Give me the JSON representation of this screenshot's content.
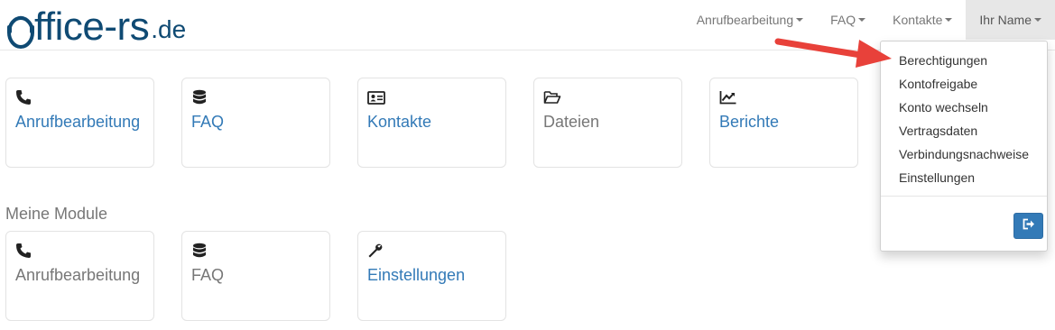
{
  "logo": {
    "main": "ffice-rs",
    "tld": ".de"
  },
  "nav": {
    "items": [
      {
        "label": "Anrufbearbeitung"
      },
      {
        "label": "FAQ"
      },
      {
        "label": "Kontakte"
      },
      {
        "label": "Ihr Name"
      }
    ]
  },
  "dropdown": {
    "items": [
      {
        "label": "Berechtigungen"
      },
      {
        "label": "Kontofreigabe"
      },
      {
        "label": "Konto wechseln"
      },
      {
        "label": "Vertragsdaten"
      },
      {
        "label": "Verbindungsnachweise"
      },
      {
        "label": "Einstellungen"
      }
    ],
    "logout_icon": "sign-out-icon"
  },
  "tiles": [
    {
      "label": "Anrufbearbeitung",
      "icon": "phone-icon"
    },
    {
      "label": "FAQ",
      "icon": "database-icon"
    },
    {
      "label": "Kontakte",
      "icon": "contact-card-icon"
    },
    {
      "label": "Dateien",
      "icon": "folder-open-icon"
    },
    {
      "label": "Berichte",
      "icon": "chart-line-icon"
    }
  ],
  "modules": {
    "title": "Meine Module",
    "tiles": [
      {
        "label": "Anrufbearbeitung",
        "icon": "phone-icon"
      },
      {
        "label": "FAQ",
        "icon": "database-icon"
      },
      {
        "label": "Einstellungen",
        "icon": "wrench-icon"
      }
    ]
  },
  "colors": {
    "brand": "#0f4a73",
    "link": "#337ab7",
    "muted": "#777777",
    "arrow": "#e8413a"
  }
}
